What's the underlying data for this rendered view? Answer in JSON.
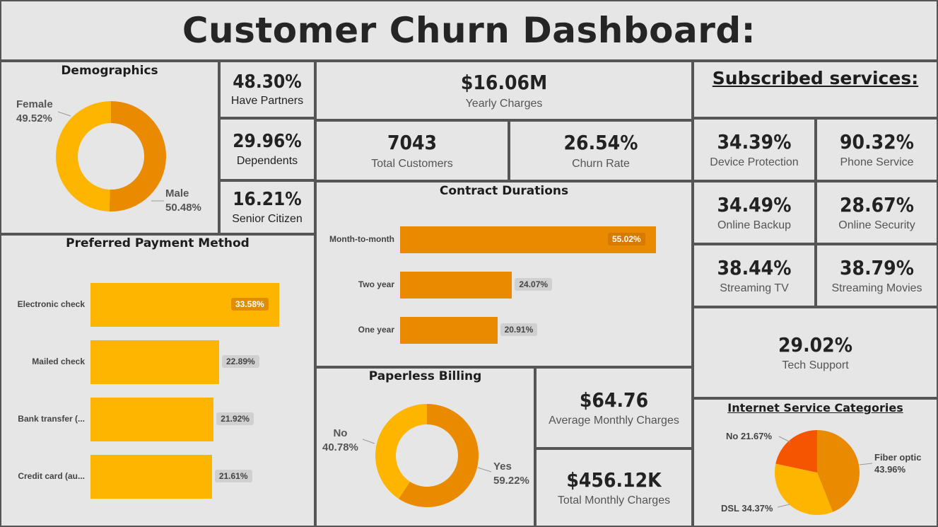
{
  "title": "Customer Churn Dashboard:",
  "colors": {
    "orange_dark": "#e98a00",
    "orange_light": "#fdb500",
    "red_orange": "#f55400",
    "bg": "#e6e6e6",
    "border": "#555555"
  },
  "demographics": {
    "title": "Demographics",
    "female": {
      "name": "Female",
      "pct": "49.52%",
      "value": 49.52
    },
    "male": {
      "name": "Male",
      "pct": "50.48%",
      "value": 50.48
    }
  },
  "kpis_left": [
    {
      "value": "48.30%",
      "label": "Have Partners"
    },
    {
      "value": "29.96%",
      "label": "Dependents"
    },
    {
      "value": "16.21%",
      "label": "Senior Citizen"
    }
  ],
  "yearly": {
    "value": "$16.06M",
    "label": "Yearly Charges"
  },
  "total_customers": {
    "value": "7043",
    "label": "Total Customers"
  },
  "churn_rate": {
    "value": "26.54%",
    "label": "Churn Rate"
  },
  "contract": {
    "title": "Contract Durations",
    "categories": [
      "Month-to-month",
      "Two year",
      "One year"
    ],
    "values": [
      55.02,
      24.07,
      20.91
    ],
    "labels": [
      "55.02%",
      "24.07%",
      "20.91%"
    ]
  },
  "payment": {
    "title": "Preferred Payment Method",
    "categories": [
      "Electronic check",
      "Mailed check",
      "Bank transfer (...",
      "Credit card (au..."
    ],
    "values": [
      33.58,
      22.89,
      21.92,
      21.61
    ],
    "labels": [
      "33.58%",
      "22.89%",
      "21.92%",
      "21.61%"
    ]
  },
  "paperless": {
    "title": "Paperless Billing",
    "no": {
      "name": "No",
      "pct": "40.78%",
      "value": 40.78
    },
    "yes": {
      "name": "Yes",
      "pct": "59.22%",
      "value": 59.22
    }
  },
  "avg_monthly": {
    "value": "$64.76",
    "label": "Average Monthly Charges"
  },
  "total_monthly": {
    "value": "$456.12K",
    "label": "Total Monthly Charges"
  },
  "subscribed": {
    "title": "Subscribed services:",
    "items": [
      {
        "value": "34.39%",
        "label": "Device Protection"
      },
      {
        "value": "90.32%",
        "label": "Phone Service"
      },
      {
        "value": "34.49%",
        "label": "Online Backup"
      },
      {
        "value": "28.67%",
        "label": "Online Security"
      },
      {
        "value": "38.44%",
        "label": "Streaming TV"
      },
      {
        "value": "38.79%",
        "label": "Streaming Movies"
      }
    ],
    "tech": {
      "value": "29.02%",
      "label": "Tech Support"
    }
  },
  "internet": {
    "title": "Internet Service Categories",
    "fiber": {
      "label": "Fiber optic",
      "pct": "43.96%",
      "value": 43.96
    },
    "dsl": {
      "label": "DSL 34.37%",
      "value": 34.37
    },
    "no": {
      "label": "No 21.67%",
      "value": 21.67
    }
  },
  "chart_data": [
    {
      "type": "pie",
      "title": "Demographics",
      "categories": [
        "Female",
        "Male"
      ],
      "values": [
        49.52,
        50.48
      ]
    },
    {
      "type": "bar",
      "title": "Contract Durations",
      "categories": [
        "Month-to-month",
        "Two year",
        "One year"
      ],
      "values": [
        55.02,
        24.07,
        20.91
      ]
    },
    {
      "type": "bar",
      "title": "Preferred Payment Method",
      "categories": [
        "Electronic check",
        "Mailed check",
        "Bank transfer (...",
        "Credit card (au..."
      ],
      "values": [
        33.58,
        22.89,
        21.92,
        21.61
      ]
    },
    {
      "type": "pie",
      "title": "Paperless Billing",
      "categories": [
        "No",
        "Yes"
      ],
      "values": [
        40.78,
        59.22
      ]
    },
    {
      "type": "pie",
      "title": "Internet Service Categories",
      "categories": [
        "Fiber optic",
        "DSL",
        "No"
      ],
      "values": [
        43.96,
        34.37,
        21.67
      ]
    }
  ]
}
